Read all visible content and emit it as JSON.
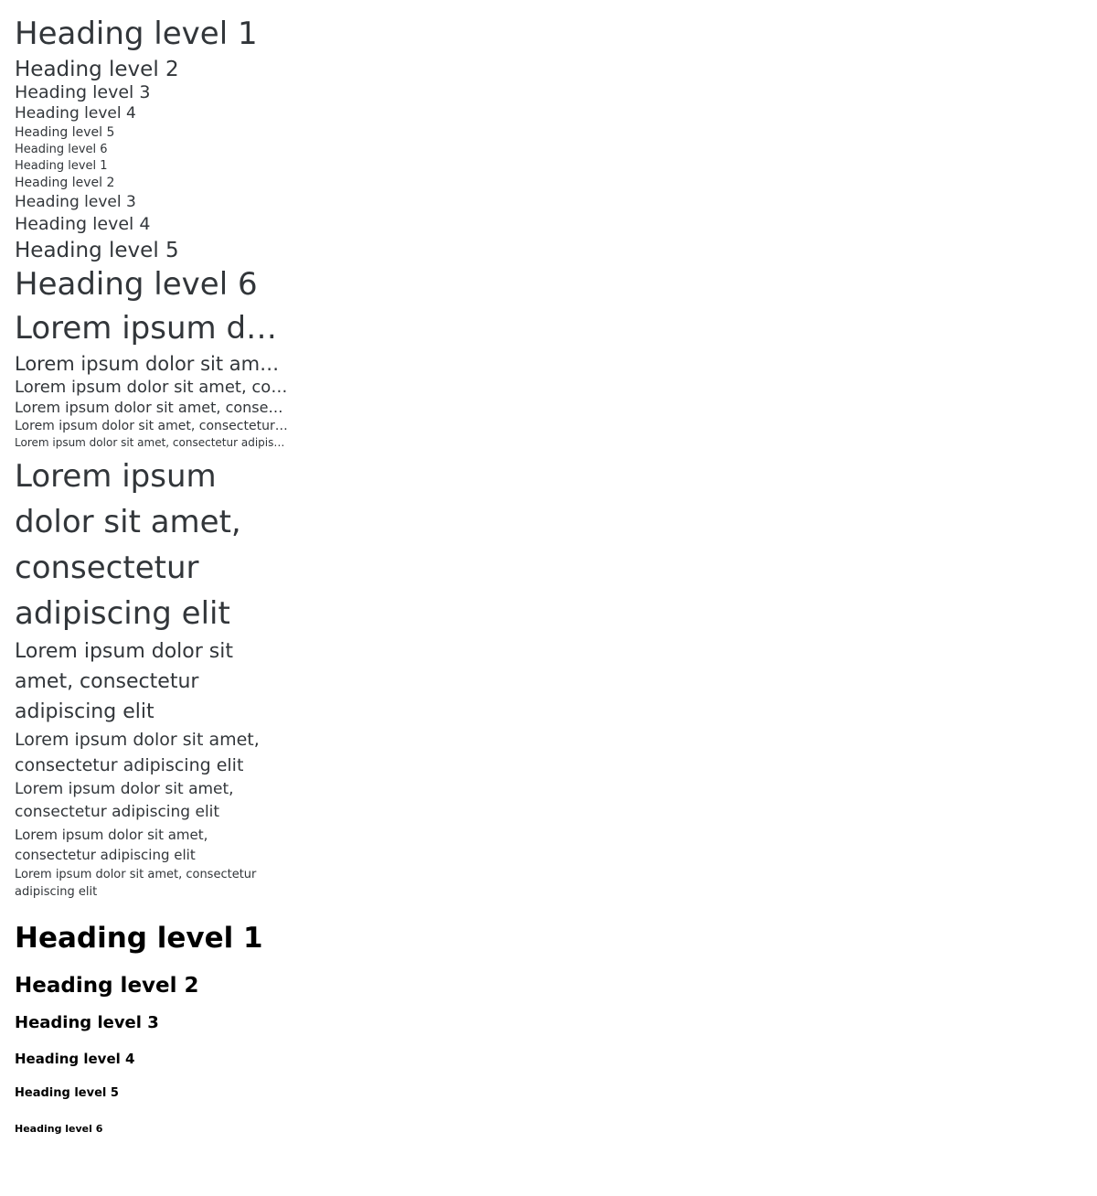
{
  "section_default": {
    "items": [
      "Heading level 1",
      "Heading level 2",
      "Heading level 3",
      "Heading level 4",
      "Heading level 5",
      "Heading level 6"
    ]
  },
  "section_mixed": {
    "items": [
      "Heading level 1",
      "Heading level 2",
      "Heading level 3",
      "Heading level 4",
      "Heading level 5",
      "Heading level 6"
    ]
  },
  "section_truncated": {
    "text": "Lorem ipsum dolor sit amet, consectetur adipiscing elit"
  },
  "section_wrapping": {
    "text": "Lorem ipsum dolor sit amet, consectetur adipiscing elit"
  },
  "section_bold": {
    "items": [
      "Heading level 1",
      "Heading level 2",
      "Heading level 3",
      "Heading level 4",
      "Heading level 5",
      "Heading level 6"
    ]
  }
}
